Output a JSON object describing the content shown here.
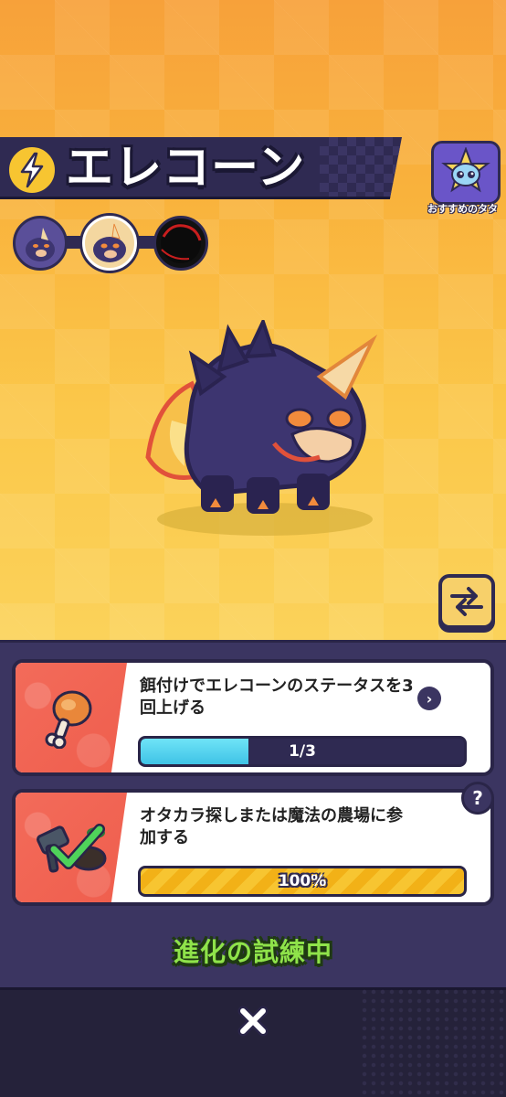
{
  "header": {
    "title": "エレコーン",
    "recommend_label": "おすすめのタタ"
  },
  "evolution": {
    "stages": [
      "stage-1",
      "stage-2",
      "stage-3"
    ],
    "current_stage": 2
  },
  "tasks": [
    {
      "text": "餌付けでエレコーンのステータスを3回上げる",
      "progress_label": "1/3",
      "progress_fraction": 0.333
    },
    {
      "text": "オタカラ探しまたは魔法の農場に参加する",
      "progress_label": "100%",
      "progress_fraction": 1.0
    }
  ],
  "help_glyph": "?",
  "status_text": "進化の試練中",
  "colors": {
    "accent_orange": "#f9b23c",
    "panel": "#3b3561",
    "status_green": "#8fe34a",
    "progress_blue": "#3fc3e6",
    "progress_yellow": "#f7c531"
  }
}
